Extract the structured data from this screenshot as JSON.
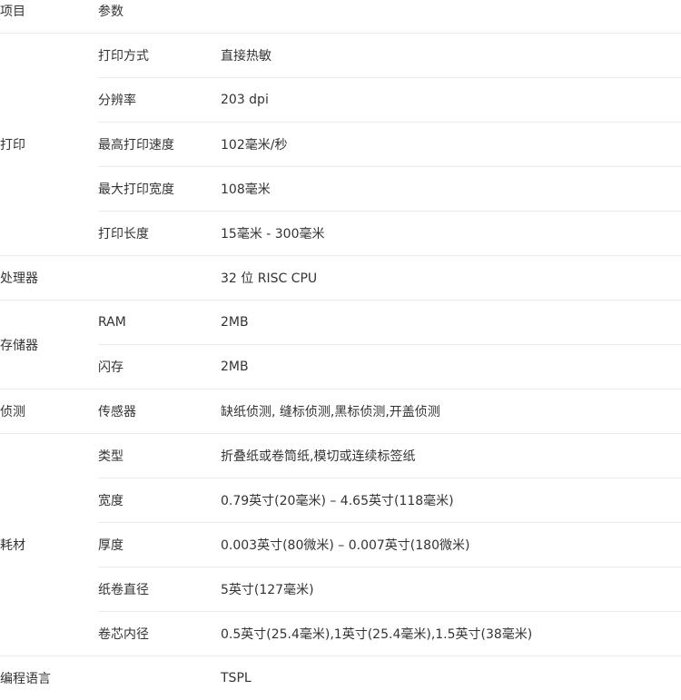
{
  "header": {
    "item": "项目",
    "param": "参数"
  },
  "groups": {
    "print": {
      "label": "打印",
      "rows": [
        {
          "name": "打印方式",
          "value": "直接热敏"
        },
        {
          "name": "分辨率",
          "value": "203 dpi"
        },
        {
          "name": "最高打印速度",
          "value": "102毫米/秒"
        },
        {
          "name": "最大打印宽度",
          "value": "108毫米"
        },
        {
          "name": "打印长度",
          "value": "15毫米 - 300毫米"
        }
      ]
    },
    "processor": {
      "label": "处理器",
      "value": "32 位 RISC CPU"
    },
    "storage": {
      "label": "存储器",
      "rows": [
        {
          "name": "RAM",
          "value": "2MB"
        },
        {
          "name": "闪存",
          "value": "2MB"
        }
      ]
    },
    "detect": {
      "label": "侦测",
      "rows": [
        {
          "name": "传感器",
          "value": "缺纸侦测, 缝标侦测,黑标侦测,开盖侦测"
        }
      ]
    },
    "media": {
      "label": "耗材",
      "rows": [
        {
          "name": "类型",
          "value": "折叠纸或卷筒纸,模切或连续标签纸"
        },
        {
          "name": "宽度",
          "value": "0.79英寸(20毫米) – 4.65英寸(118毫米)"
        },
        {
          "name": "厚度",
          "value": "0.003英寸(80微米) – 0.007英寸(180微米)"
        },
        {
          "name": "纸卷直径",
          "value": "5英寸(127毫米)"
        },
        {
          "name": "卷芯内径",
          "value": "0.5英寸(25.4毫米),1英寸(25.4毫米),1.5英寸(38毫米)"
        }
      ]
    },
    "lang": {
      "label": "编程语言",
      "value": "TSPL"
    }
  }
}
